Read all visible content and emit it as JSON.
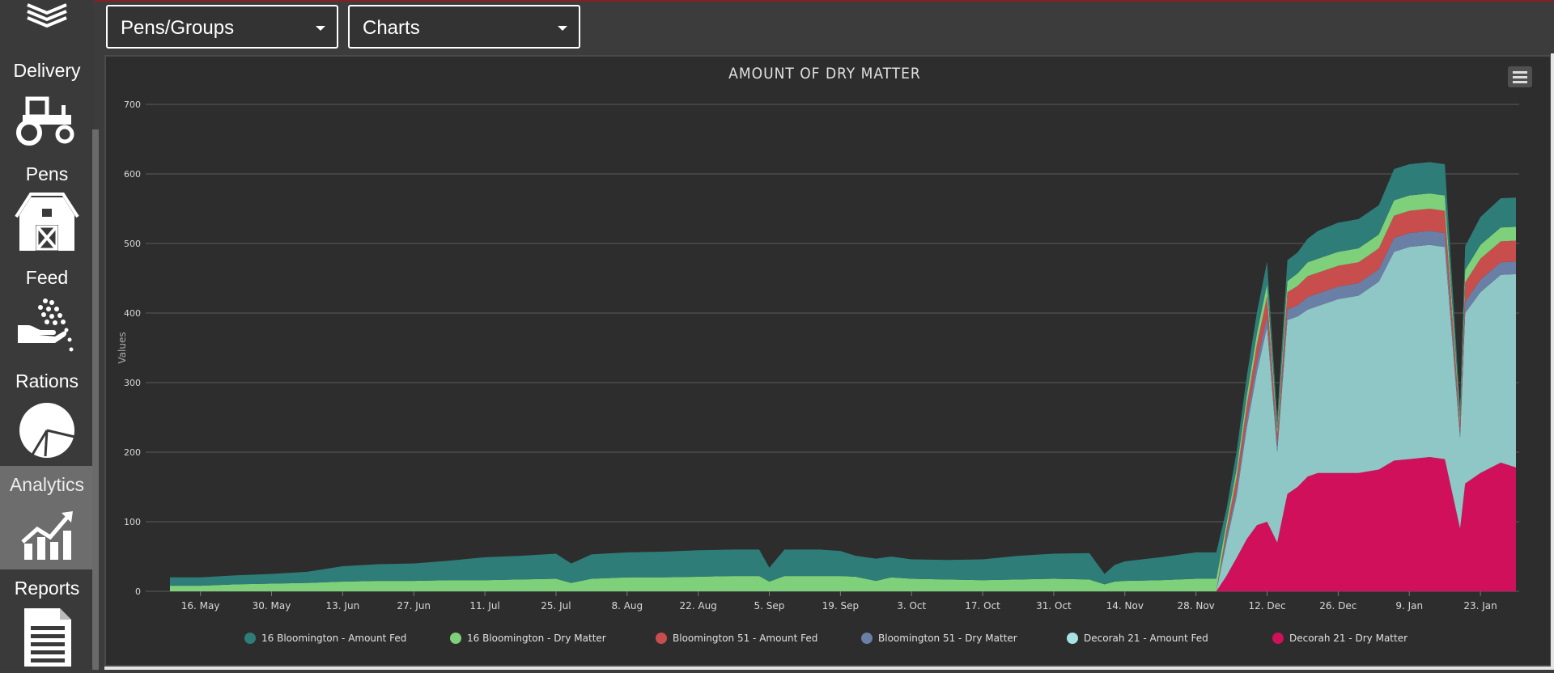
{
  "top_bar": {
    "pens_dropdown": "Pens/Groups",
    "view_dropdown": "Charts"
  },
  "sidebar": {
    "items": [
      {
        "label": "Delivery",
        "icon": "tractor-icon"
      },
      {
        "label": "Pens",
        "icon": "barn-icon"
      },
      {
        "label": "Feed",
        "icon": "feed-hand-icon"
      },
      {
        "label": "Rations",
        "icon": "pie-chart-icon"
      },
      {
        "label": "Analytics",
        "icon": "analytics-icon",
        "active": true
      },
      {
        "label": "Reports",
        "icon": "report-document-icon"
      }
    ]
  },
  "chart_data": {
    "type": "area",
    "title": "AMOUNT OF DRY MATTER",
    "ylabel": "Values",
    "ylim": [
      0,
      700
    ],
    "yticks": [
      0,
      100,
      200,
      300,
      400,
      500,
      600,
      700
    ],
    "xticks": [
      "16. May",
      "30. May",
      "13. Jun",
      "27. Jun",
      "11. Jul",
      "25. Jul",
      "8. Aug",
      "22. Aug",
      "5. Sep",
      "19. Sep",
      "3. Oct",
      "17. Oct",
      "31. Oct",
      "14. Nov",
      "28. Nov",
      "12. Dec",
      "26. Dec",
      "9. Jan",
      "23. Jan"
    ],
    "stacking": "normal",
    "grid": true,
    "legend_position": "bottom",
    "x_dates": [
      "05-10",
      "05-16",
      "05-23",
      "05-30",
      "06-06",
      "06-13",
      "06-20",
      "06-27",
      "07-04",
      "07-11",
      "07-18",
      "07-25",
      "07-28",
      "08-01",
      "08-08",
      "08-15",
      "08-22",
      "08-29",
      "09-03",
      "09-05",
      "09-08",
      "09-15",
      "09-19",
      "09-22",
      "09-26",
      "09-29",
      "10-03",
      "10-10",
      "10-17",
      "10-24",
      "10-31",
      "11-07",
      "11-10",
      "11-12",
      "11-14",
      "11-21",
      "11-28",
      "12-02",
      "12-04",
      "12-06",
      "12-08",
      "12-10",
      "12-12",
      "12-14",
      "12-16",
      "12-18",
      "12-20",
      "12-22",
      "12-26",
      "12-30",
      "01-03",
      "01-06",
      "01-09",
      "01-13",
      "01-16",
      "01-19",
      "01-20",
      "01-23",
      "01-27",
      "01-30"
    ],
    "series": [
      {
        "name": "Decorah 21 - Dry Matter",
        "color": "#d0105a",
        "values": [
          0,
          0,
          0,
          0,
          0,
          0,
          0,
          0,
          0,
          0,
          0,
          0,
          0,
          0,
          0,
          0,
          0,
          0,
          0,
          0,
          0,
          0,
          0,
          0,
          0,
          0,
          0,
          0,
          0,
          0,
          0,
          0,
          0,
          0,
          0,
          0,
          0,
          0,
          22,
          48,
          75,
          95,
          100,
          70,
          140,
          150,
          165,
          170,
          170,
          170,
          175,
          188,
          190,
          193,
          190,
          90,
          155,
          170,
          185,
          178
        ]
      },
      {
        "name": "Decorah 21 - Amount Fed",
        "color": "#8fc6c6",
        "values": [
          0,
          0,
          0,
          0,
          0,
          0,
          0,
          0,
          0,
          0,
          0,
          0,
          0,
          0,
          0,
          0,
          0,
          0,
          0,
          0,
          0,
          0,
          0,
          0,
          0,
          0,
          0,
          0,
          0,
          0,
          0,
          0,
          0,
          0,
          0,
          0,
          0,
          0,
          48,
          88,
          160,
          220,
          280,
          130,
          250,
          245,
          240,
          240,
          250,
          255,
          270,
          300,
          305,
          305,
          305,
          130,
          245,
          260,
          270,
          278
        ]
      },
      {
        "name": "Bloomington 51 - Dry Matter",
        "color": "#6a7fa5",
        "values": [
          0,
          0,
          0,
          0,
          0,
          0,
          0,
          0,
          0,
          0,
          0,
          0,
          0,
          0,
          0,
          0,
          0,
          0,
          0,
          0,
          0,
          0,
          0,
          0,
          0,
          0,
          0,
          0,
          0,
          0,
          0,
          0,
          0,
          0,
          0,
          0,
          0,
          0,
          8,
          10,
          12,
          15,
          16,
          10,
          15,
          16,
          18,
          18,
          18,
          18,
          18,
          20,
          20,
          20,
          20,
          8,
          16,
          18,
          18,
          18
        ]
      },
      {
        "name": "Bloomington 51 - Amount Fed",
        "color": "#c84e4e",
        "values": [
          0,
          0,
          0,
          0,
          0,
          0,
          0,
          0,
          0,
          0,
          0,
          0,
          0,
          0,
          0,
          0,
          0,
          0,
          0,
          0,
          0,
          0,
          0,
          0,
          0,
          0,
          0,
          0,
          0,
          0,
          0,
          0,
          0,
          0,
          0,
          0,
          0,
          0,
          10,
          18,
          20,
          25,
          28,
          14,
          25,
          28,
          30,
          30,
          30,
          30,
          30,
          32,
          32,
          32,
          32,
          12,
          28,
          30,
          30,
          30
        ]
      },
      {
        "name": "16 Bloomington - Dry Matter",
        "color": "#7fd07a",
        "values": [
          8,
          8,
          10,
          11,
          12,
          14,
          15,
          15,
          16,
          16,
          17,
          18,
          12,
          18,
          20,
          20,
          21,
          22,
          22,
          14,
          22,
          22,
          22,
          21,
          15,
          20,
          18,
          17,
          16,
          17,
          18,
          17,
          10,
          14,
          15,
          16,
          18,
          18,
          10,
          12,
          14,
          16,
          18,
          10,
          16,
          18,
          20,
          20,
          20,
          20,
          20,
          22,
          22,
          22,
          22,
          10,
          18,
          20,
          20,
          20
        ]
      },
      {
        "name": "16 Bloomington - Amount Fed",
        "color": "#2e7d78",
        "values": [
          12,
          12,
          13,
          14,
          16,
          22,
          24,
          25,
          28,
          33,
          34,
          36,
          28,
          35,
          36,
          37,
          38,
          38,
          38,
          20,
          38,
          38,
          36,
          30,
          32,
          30,
          28,
          28,
          30,
          34,
          36,
          38,
          15,
          24,
          28,
          33,
          38,
          38,
          20,
          25,
          28,
          30,
          32,
          16,
          30,
          30,
          34,
          40,
          42,
          42,
          42,
          45,
          45,
          45,
          45,
          14,
          34,
          40,
          42,
          42
        ]
      }
    ]
  },
  "legend": [
    {
      "label": "16 Bloomington - Amount Fed",
      "color": "#2e7d78"
    },
    {
      "label": "16 Bloomington - Dry Matter",
      "color": "#7fd07a"
    },
    {
      "label": "Bloomington 51 - Amount Fed",
      "color": "#c84e4e"
    },
    {
      "label": "Bloomington 51 - Dry Matter",
      "color": "#6a7fa5"
    },
    {
      "label": "Decorah 21 - Amount Fed",
      "color": "#a8e3e3"
    },
    {
      "label": "Decorah 21 - Dry Matter",
      "color": "#d0105a"
    }
  ]
}
